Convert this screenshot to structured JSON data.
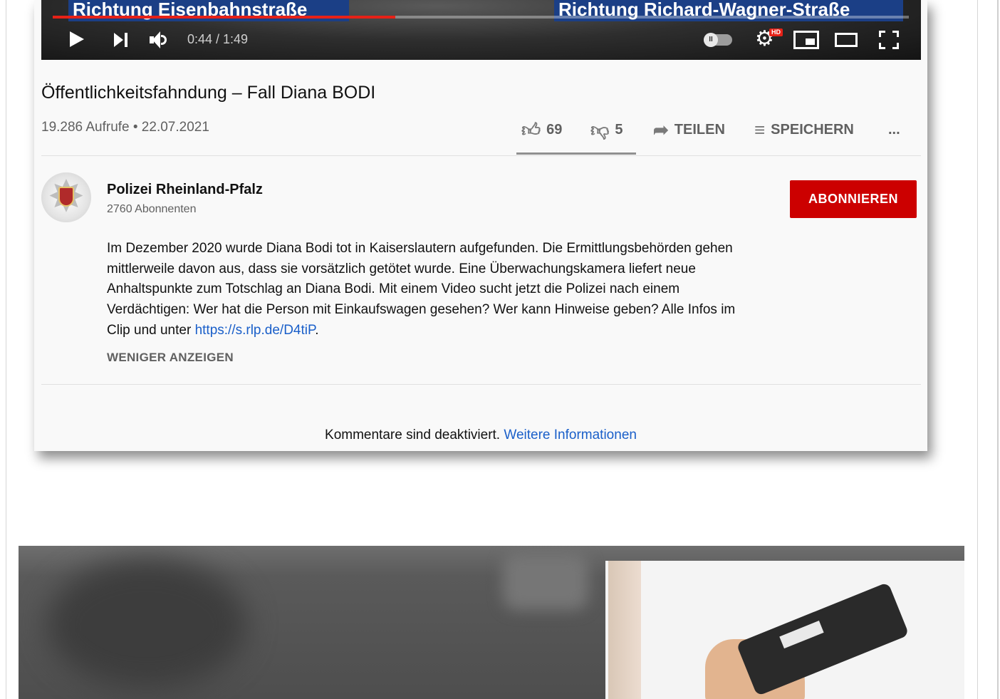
{
  "player": {
    "street_left": "Richtung Eisenbahnstraße",
    "street_right": "Richtung Richard-Wagner-Straße",
    "time": "0:44 / 1:49",
    "progress": 0.4,
    "hd_badge": "HD",
    "icons": [
      "play-icon",
      "next-icon",
      "volume-icon",
      "autoplay-toggle",
      "settings-gear-icon",
      "miniplayer-icon",
      "theater-mode-icon",
      "fullscreen-icon"
    ]
  },
  "video": {
    "title": "Öffentlichkeitsfahndung – Fall Diana BODI",
    "meta": "19.286 Aufrufe • 22.07.2021",
    "likes": "69",
    "dislikes": "5",
    "share_label": "TEILEN",
    "save_label": "SPEICHERN",
    "more_label": "..."
  },
  "channel": {
    "name": "Polizei Rheinland-Pfalz",
    "subscribers": "2760 Abonnenten",
    "subscribe_label": "ABONNIEREN"
  },
  "description": {
    "text": "Im Dezember 2020 wurde Diana Bodi tot in Kaiserslautern aufgefunden. Die Ermittlungsbehörden gehen mittlerweile davon aus, dass sie vorsätzlich getötet wurde. Eine Überwachungskamera liefert neue Anhaltspunkte zum Totschlag an Diana Bodi. Mit einem Video sucht jetzt die Polizei nach einem Verdächtigen: Wer hat die Person mit Einkaufswagen gesehen? Wer kann Hinweise geben? Alle Infos im Clip und unter ",
    "link": "https://s.rlp.de/D4tiP",
    "after_link": ".",
    "show_less": "WENIGER ANZEIGEN"
  },
  "comments": {
    "text": "Kommentare sind deaktiviert. ",
    "link": "Weitere Informationen"
  },
  "colors": {
    "subscribe": "#cc0000",
    "link": "#1a5fc9",
    "progress": "#e62117",
    "street_sign": "#1b3f86"
  }
}
